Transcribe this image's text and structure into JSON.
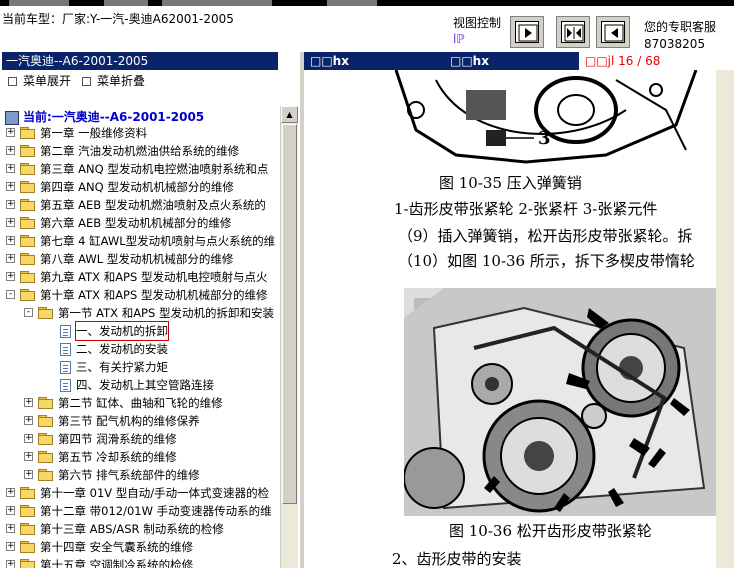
{
  "top": {
    "car_type": "当前车型：厂家:Y-一汽-奥迪A62001-2005",
    "view_control": "视图控制",
    "view_icon": "lℙ",
    "service": "您的专职客服",
    "phone": "87038205"
  },
  "left": {
    "title": "一汽奥迪--A6-2001-2005",
    "menu_expand": "菜单展开",
    "menu_collapse": "菜单折叠",
    "current": "当前:一汽奥迪--A6-2001-2005",
    "tree": [
      {
        "level": 0,
        "label": "第一章 一般维修资料",
        "exp": "+"
      },
      {
        "level": 0,
        "label": "第二章 汽油发动机燃油供给系统的维修",
        "exp": "+"
      },
      {
        "level": 0,
        "label": "第三章 ANQ 型发动机电控燃油喷射系统和点",
        "exp": "+"
      },
      {
        "level": 0,
        "label": "第四章 ANQ 型发动机机械部分的维修",
        "exp": "+"
      },
      {
        "level": 0,
        "label": "第五章 AEB 型发动机燃油喷射及点火系统的",
        "exp": "+"
      },
      {
        "level": 0,
        "label": "第六章 AEB 型发动机机械部分的维修",
        "exp": "+"
      },
      {
        "level": 0,
        "label": "第七章 4 缸AWL型发动机喷射与点火系统的维",
        "exp": "+"
      },
      {
        "level": 0,
        "label": "第八章 AWL 型发动机机械部分的维修",
        "exp": "+"
      },
      {
        "level": 0,
        "label": "第九章 ATX 和APS 型发动机电控喷射与点火",
        "exp": "+"
      },
      {
        "level": 0,
        "label": "第十章 ATX 和APS 型发动机机械部分的维修",
        "exp": "-"
      },
      {
        "level": 1,
        "label": "第一节 ATX 和APS 型发动机的拆卸和安装",
        "exp": "-"
      },
      {
        "level": 2,
        "label": "一、发动机的拆卸",
        "exp": ""
      },
      {
        "level": 2,
        "label": "二、发动机的安装",
        "exp": ""
      },
      {
        "level": 2,
        "label": "三、有关拧紧力矩",
        "exp": ""
      },
      {
        "level": 2,
        "label": "四、发动机上其空管路连接",
        "exp": ""
      },
      {
        "level": 1,
        "label": "第二节 缸体、曲轴和飞轮的维修",
        "exp": "+"
      },
      {
        "level": 1,
        "label": "第三节 配气机构的维修保养",
        "exp": "+"
      },
      {
        "level": 1,
        "label": "第四节 润滑系统的维修",
        "exp": "+"
      },
      {
        "level": 1,
        "label": "第五节 冷却系统的维修",
        "exp": "+"
      },
      {
        "level": 1,
        "label": "第六节 排气系统部件的维修",
        "exp": "+"
      },
      {
        "level": 0,
        "label": "第十一章 01V 型自动/手动一体式变速器的检",
        "exp": "+"
      },
      {
        "level": 0,
        "label": "第十二章 带012/01W 手动变速器传动系的维",
        "exp": "+"
      },
      {
        "level": 0,
        "label": "第十三章 ABS/ASR 制动系统的检修",
        "exp": "+"
      },
      {
        "level": 0,
        "label": "第十四章 安全气囊系统的维修",
        "exp": "+"
      },
      {
        "level": 0,
        "label": "第十五章 空调制冷系统的检修",
        "exp": "+"
      }
    ]
  },
  "right": {
    "tab1": "□□hx",
    "tab2": "□□hx",
    "page": "□□jl 16 / 68",
    "fig1_num": "3",
    "fig1_caption": "图 10-35   压入弹簧销",
    "legend": "1-齿形皮带张紧轮    2-张紧杆    3-张紧元件",
    "step9": "（9）插入弹簧销，松开齿形皮带张紧轮。拆",
    "step10": "（10）如图 10-36 所示，拆下多楔皮带惰轮",
    "fig2_caption": "图 10-36   松开齿形皮带张紧轮",
    "section2": "2、齿形皮带的安装"
  }
}
